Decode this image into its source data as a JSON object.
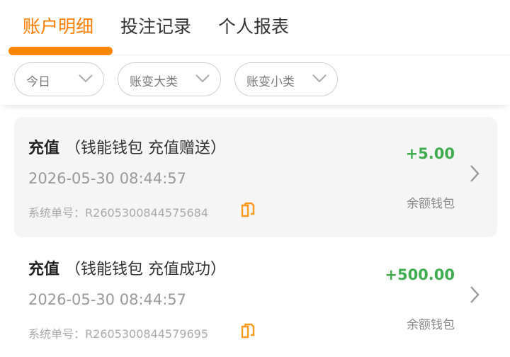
{
  "tabs": [
    {
      "label": "账户明细",
      "active": true
    },
    {
      "label": "投注记录",
      "active": false
    },
    {
      "label": "个人报表",
      "active": false
    }
  ],
  "filters": [
    {
      "label": "今日",
      "icon": "chevron-down-icon"
    },
    {
      "label": "账变大类",
      "icon": "chevron-down-icon"
    },
    {
      "label": "账变小类",
      "icon": "chevron-down-icon"
    }
  ],
  "records": [
    {
      "type": "充值",
      "subtitle": "（钱能钱包 充值赠送）",
      "time": "2026-05-30 08:44:57",
      "order_label": "系统单号：",
      "order_no": "R2605300844575684",
      "amount": "+5.00",
      "wallet": "余额钱包"
    },
    {
      "type": "充值",
      "subtitle": "（钱能钱包 充值成功）",
      "time": "2026-05-30 08:44:57",
      "order_label": "系统单号：",
      "order_no": "R2605300844579695",
      "amount": "+500.00",
      "wallet": "余额钱包"
    }
  ],
  "colors": {
    "accent": "#ff8800",
    "positive": "#3fad4f",
    "card_highlight": "#f5f5f5"
  }
}
